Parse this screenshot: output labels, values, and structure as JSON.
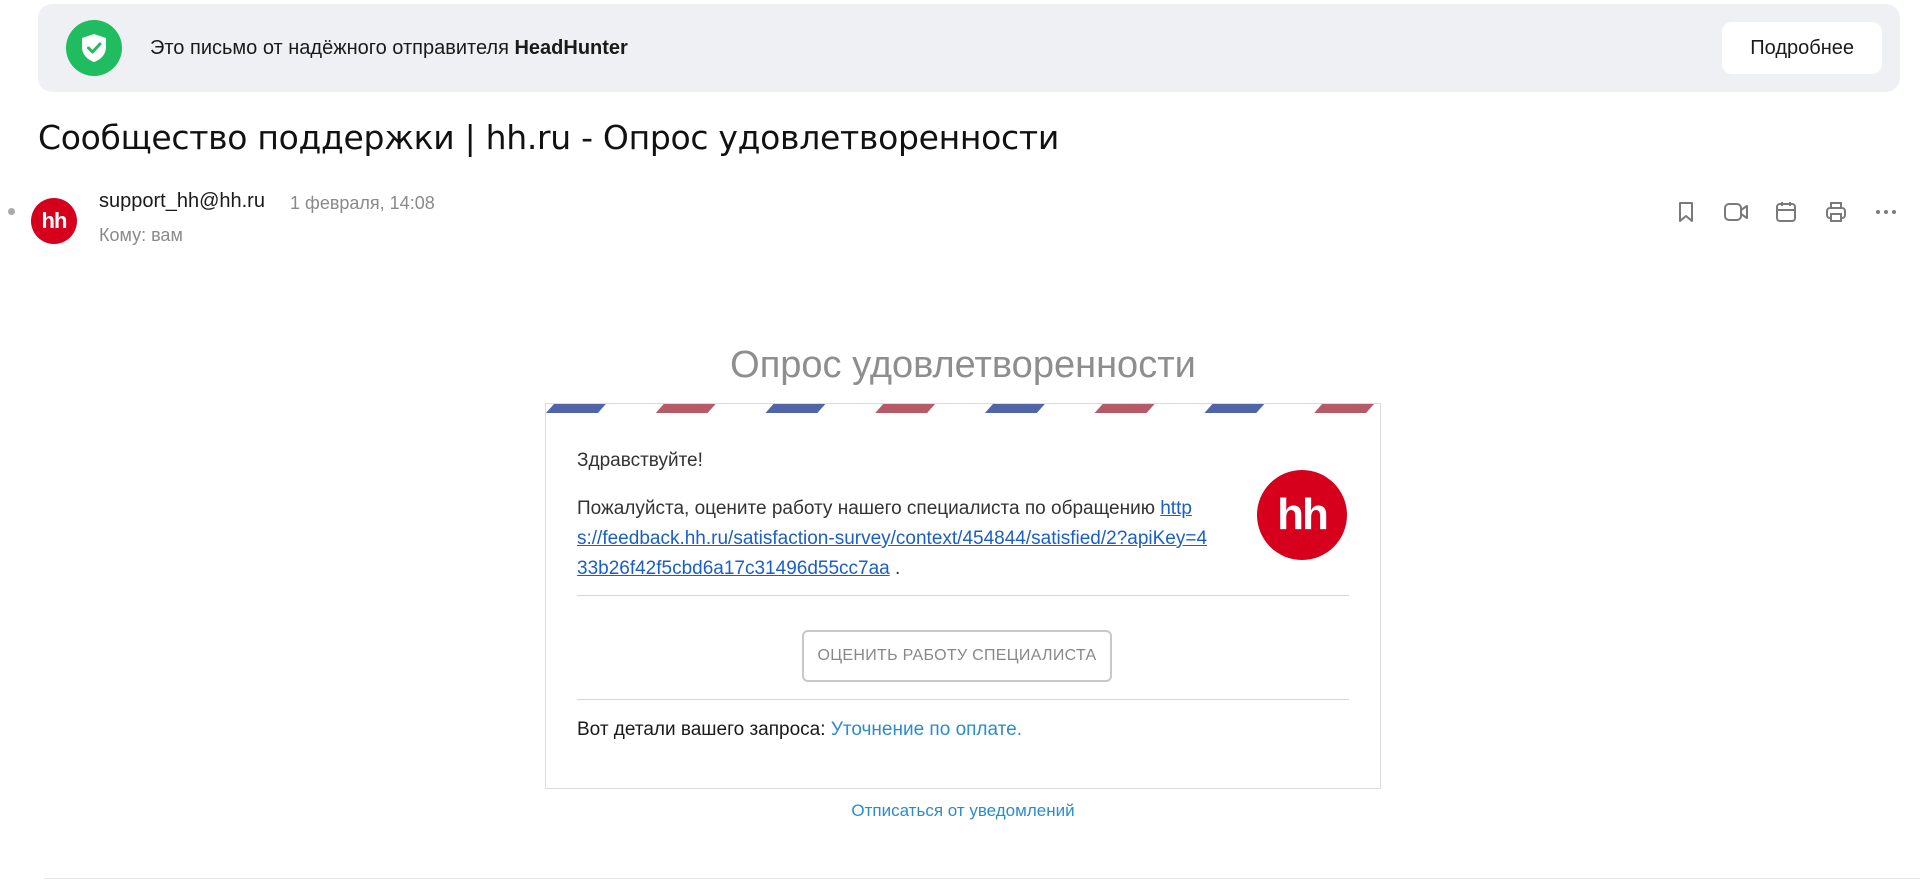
{
  "banner": {
    "text_prefix": "Это письмо от надёжного отправителя",
    "sender_brand": "HeadHunter",
    "more_button": "Подробнее"
  },
  "colors": {
    "trusted_green": "#1fbd5f",
    "brand_red": "#d6001c",
    "link_blue": "#1a5ec9",
    "accent_blue": "#2a8ccf"
  },
  "email": {
    "subject": "Сообщество поддержки | hh.ru - Опрос удовлетворенности",
    "avatar_text": "hh",
    "sender": "support_hh@hh.ru",
    "date": "1 февраля, 14:08",
    "to": "Кому: вам",
    "actions": [
      "bookmark-icon",
      "video-call-icon",
      "calendar-icon",
      "print-icon",
      "more-icon"
    ]
  },
  "body": {
    "title": "Опрос удовлетворенности",
    "greeting": "Здравствуйте!",
    "message": "Пожалуйста, оцените работу нашего специалиста по обращению",
    "link": "https://feedback.hh.ru/satisfaction-survey/context/454844/satisfied/2?apiKey=433b26f42f5cbd6a17c31496d55cc7aa",
    "link_suffix": " .",
    "logo_text": "hh",
    "rate_button": "ОЦЕНИТЬ РАБОТУ СПЕЦИАЛИСТА",
    "details_prefix": "Вот детали вашего запроса: ",
    "details_link": "Уточнение по оплате.",
    "unsubscribe": "Отписаться от уведомлений"
  }
}
